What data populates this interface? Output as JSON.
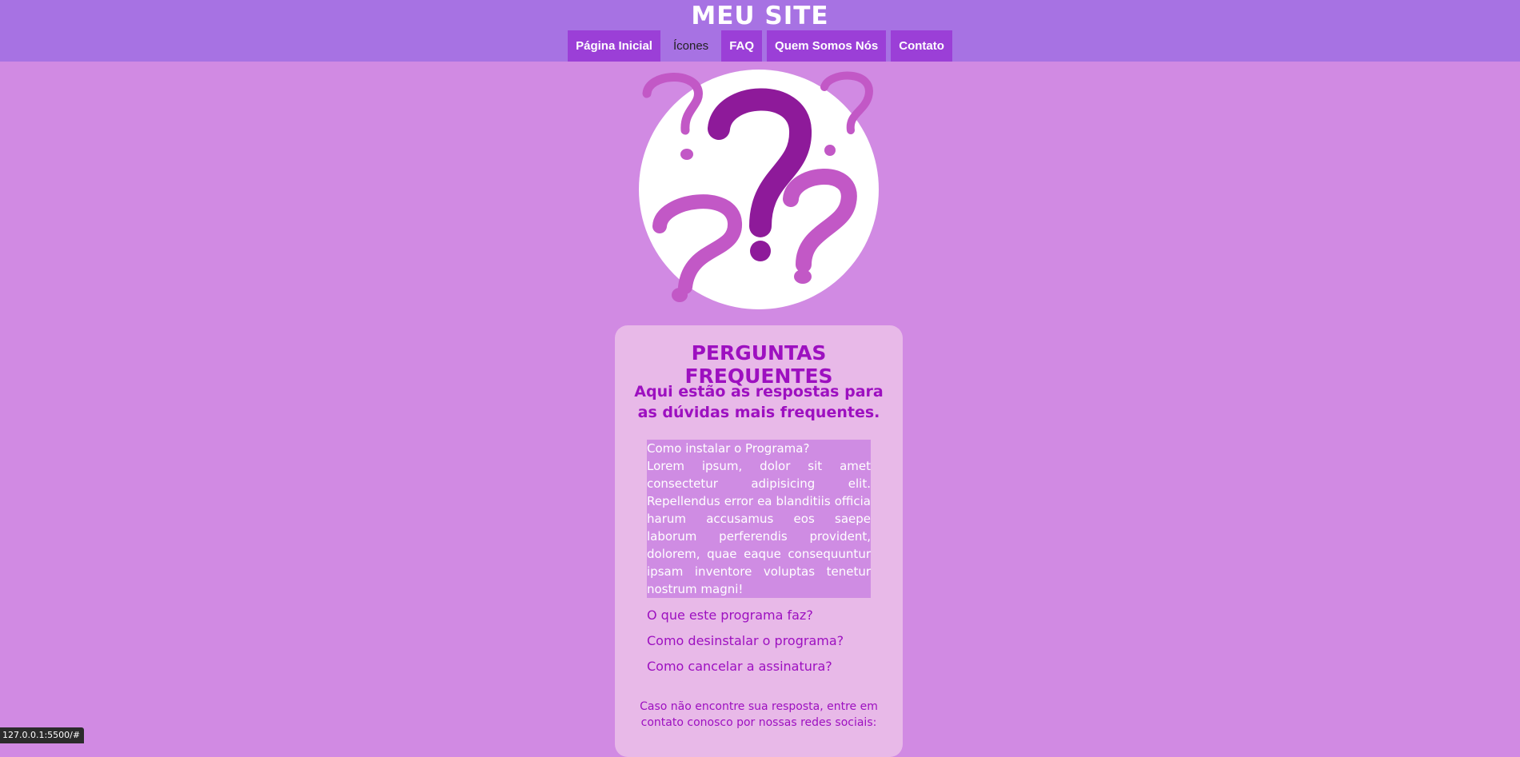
{
  "header": {
    "site_title": "MEU SITE",
    "nav": [
      {
        "label": "Página Inicial"
      },
      {
        "label": "Ícones"
      },
      {
        "label": "FAQ"
      },
      {
        "label": "Quem Somos Nós"
      },
      {
        "label": "Contato"
      }
    ]
  },
  "hero": {
    "icon": "question-marks-icon"
  },
  "faq": {
    "title": "PERGUNTAS FREQUENTES",
    "subtitle": "Aqui estão as respostas para as dúvidas mais frequentes.",
    "items": [
      {
        "question": "Como instalar o Programa?",
        "answer": "Lorem ipsum, dolor sit amet consectetur adipisicing elit. Repellendus error ea blanditiis officia harum accusamus eos saepe laborum perferendis provident, dolorem, quae eaque consequuntur ipsam inventore voluptas tenetur nostrum magni!"
      },
      {
        "question": "O que este programa faz?"
      },
      {
        "question": "Como desinstalar o programa?"
      },
      {
        "question": "Como cancelar a assinatura?"
      }
    ],
    "footer": "Caso não encontre sua resposta, entre em contato conosco por nossas redes sociais:"
  },
  "status_bar": {
    "url": "127.0.0.1:5500/#"
  },
  "colors": {
    "page_background": "#d18ae3",
    "header_background": "#a772e3",
    "nav_button": "#9b3fd7",
    "card_background": "#e8b9e8",
    "accent_text": "#9d10c0",
    "question_mark_dark": "#8e1a9a",
    "question_mark_light": "#c258c6"
  }
}
